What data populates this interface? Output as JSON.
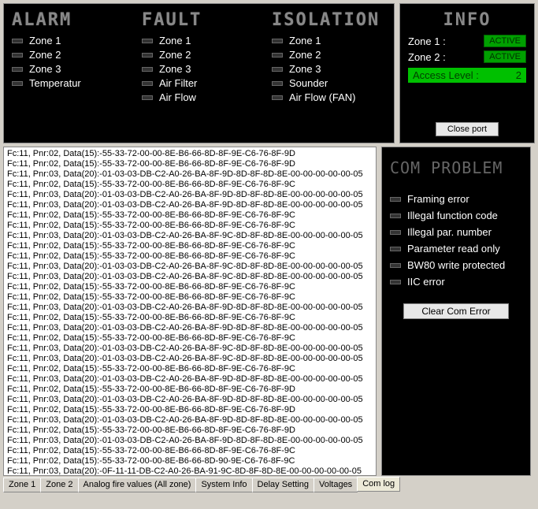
{
  "headers": {
    "alarm": "ALARM",
    "fault": "FAULT",
    "isolation": "ISOLATION",
    "info": "INFO",
    "com_problem": "COM PROBLEM"
  },
  "alarm_items": [
    "Zone 1",
    "Zone 2",
    "Zone 3",
    "Temperatur"
  ],
  "fault_items": [
    "Zone 1",
    "Zone 2",
    "Zone 3",
    "Air Filter",
    "Air Flow"
  ],
  "isolation_items": [
    "Zone 1",
    "Zone 2",
    "Zone 3",
    "Sounder",
    "Air Flow (FAN)"
  ],
  "info": {
    "zone1_label": "Zone 1 :",
    "zone1_status": "ACTIVE",
    "zone2_label": "Zone 2 :",
    "zone2_status": "ACTIVE",
    "access_label": "Access Level :",
    "access_value": "2",
    "close_port": "Close port"
  },
  "com_items": [
    "Framing error",
    "Illegal function  code",
    "Illegal par. number",
    "Parameter read only",
    "BW80 write protected",
    "IIC error"
  ],
  "clear_com": "Clear Com Error",
  "tabs": [
    "Zone 1",
    "Zone 2",
    "Analog fire values (All zone)",
    "System Info",
    "Delay Setting",
    "Voltages",
    "Com log"
  ],
  "active_tab": 6,
  "log_lines": [
    "Fc:11, Pnr:02, Data(15):-55-33-72-00-00-8E-B6-66-8D-8F-9E-C6-76-8F-9D",
    "Fc:11, Pnr:02, Data(15):-55-33-72-00-00-8E-B6-66-8D-8F-9E-C6-76-8F-9D",
    "Fc:11, Pnr:03, Data(20):-01-03-03-DB-C2-A0-26-BA-8F-9D-8D-8F-8D-8E-00-00-00-00-00-05",
    "Fc:11, Pnr:02, Data(15):-55-33-72-00-00-8E-B6-66-8D-8F-9E-C6-76-8F-9C",
    "Fc:11, Pnr:03, Data(20):-01-03-03-DB-C2-A0-26-BA-8F-9D-8D-8F-8D-8E-00-00-00-00-00-05",
    "Fc:11, Pnr:03, Data(20):-01-03-03-DB-C2-A0-26-BA-8F-9D-8D-8F-8D-8E-00-00-00-00-00-05",
    "Fc:11, Pnr:02, Data(15):-55-33-72-00-00-8E-B6-66-8D-8F-9E-C6-76-8F-9C",
    "Fc:11, Pnr:02, Data(15):-55-33-72-00-00-8E-B6-66-8D-8F-9E-C6-76-8F-9C",
    "Fc:11, Pnr:03, Data(20):-01-03-03-DB-C2-A0-26-BA-8F-9C-8D-8F-8D-8E-00-00-00-00-00-05",
    "Fc:11, Pnr:02, Data(15):-55-33-72-00-00-8E-B6-66-8D-8F-9E-C6-76-8F-9C",
    "Fc:11, Pnr:02, Data(15):-55-33-72-00-00-8E-B6-66-8D-8F-9E-C6-76-8F-9C",
    "Fc:11, Pnr:03, Data(20):-01-03-03-DB-C2-A0-26-BA-8F-9C-8D-8F-8D-8E-00-00-00-00-00-05",
    "Fc:11, Pnr:03, Data(20):-01-03-03-DB-C2-A0-26-BA-8F-9C-8D-8F-8D-8E-00-00-00-00-00-05",
    "Fc:11, Pnr:02, Data(15):-55-33-72-00-00-8E-B6-66-8D-8F-9E-C6-76-8F-9C",
    "Fc:11, Pnr:02, Data(15):-55-33-72-00-00-8E-B6-66-8D-8F-9E-C6-76-8F-9C",
    "Fc:11, Pnr:03, Data(20):-01-03-03-DB-C2-A0-26-BA-8F-9D-8D-8F-8D-8E-00-00-00-00-00-05",
    "Fc:11, Pnr:02, Data(15):-55-33-72-00-00-8E-B6-66-8D-8F-9E-C6-76-8F-9C",
    "Fc:11, Pnr:03, Data(20):-01-03-03-DB-C2-A0-26-BA-8F-9D-8D-8F-8D-8E-00-00-00-00-00-05",
    "Fc:11, Pnr:02, Data(15):-55-33-72-00-00-8E-B6-66-8D-8F-9E-C6-76-8F-9C",
    "Fc:11, Pnr:03, Data(20):-01-03-03-DB-C2-A0-26-BA-8F-9C-8D-8F-8D-8E-00-00-00-00-00-05",
    "Fc:11, Pnr:03, Data(20):-01-03-03-DB-C2-A0-26-BA-8F-9C-8D-8F-8D-8E-00-00-00-00-00-05",
    "Fc:11, Pnr:02, Data(15):-55-33-72-00-00-8E-B6-66-8D-8F-9E-C6-76-8F-9C",
    "Fc:11, Pnr:03, Data(20):-01-03-03-DB-C2-A0-26-BA-8F-9D-8D-8F-8D-8E-00-00-00-00-00-05",
    "Fc:11, Pnr:02, Data(15):-55-33-72-00-00-8E-B6-66-8D-8F-9E-C6-76-8F-9D",
    "Fc:11, Pnr:03, Data(20):-01-03-03-DB-C2-A0-26-BA-8F-9D-8D-8F-8D-8E-00-00-00-00-00-05",
    "Fc:11, Pnr:02, Data(15):-55-33-72-00-00-8E-B6-66-8D-8F-9E-C6-76-8F-9D",
    "Fc:11, Pnr:03, Data(20):-01-03-03-DB-C2-A0-26-BA-8F-9D-8D-8F-8D-8E-00-00-00-00-00-05",
    "Fc:11, Pnr:02, Data(15):-55-33-72-00-00-8E-B6-66-8D-8F-9E-C6-76-8F-9D",
    "Fc:11, Pnr:03, Data(20):-01-03-03-DB-C2-A0-26-BA-8F-9D-8D-8F-8D-8E-00-00-00-00-00-05",
    "Fc:11, Pnr:02, Data(15):-55-33-72-00-00-8E-B6-66-8D-8F-9E-C6-76-8F-9C",
    "Fc:11, Pnr:02, Data(15):-55-33-72-00-00-8E-B6-66-8D-90-9E-C6-76-8F-9C",
    "Fc:11, Pnr:03, Data(20):-0F-11-11-DB-C2-A0-26-BA-91-9C-8D-8F-8D-8E-00-00-00-00-00-05"
  ]
}
